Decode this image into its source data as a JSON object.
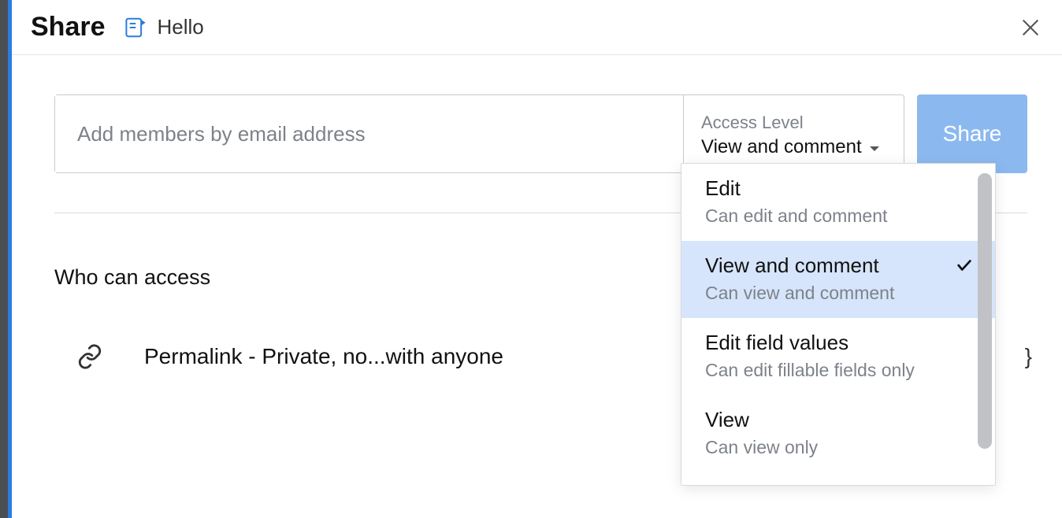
{
  "header": {
    "title": "Share",
    "doc_name": "Hello"
  },
  "add_row": {
    "placeholder": "Add members by email address",
    "access_label": "Access Level",
    "access_value": "View and comment",
    "share_label": "Share"
  },
  "section": {
    "who_can_access": "Who can access",
    "permalink": "Permalink - Private, no...with anyone"
  },
  "menu": {
    "items": [
      {
        "title": "Edit",
        "desc": "Can edit and comment",
        "selected": false
      },
      {
        "title": "View and comment",
        "desc": "Can view and comment",
        "selected": true
      },
      {
        "title": "Edit field values",
        "desc": "Can edit fillable fields only",
        "selected": false
      },
      {
        "title": "View",
        "desc": "Can view only",
        "selected": false
      }
    ]
  }
}
